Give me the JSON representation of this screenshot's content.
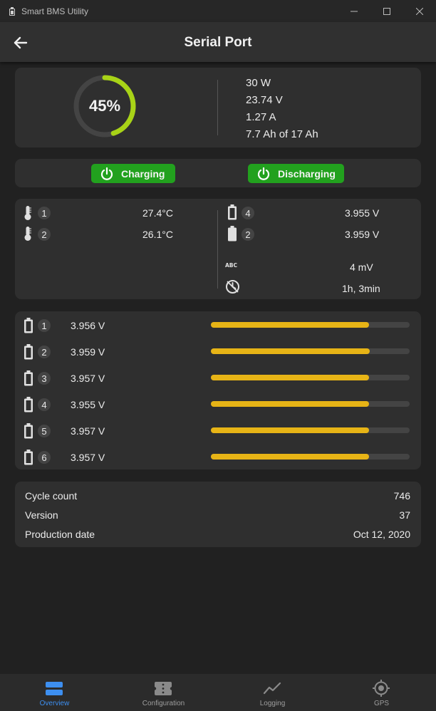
{
  "window": {
    "title": "Smart BMS Utility"
  },
  "appbar": {
    "title": "Serial Port"
  },
  "status": {
    "percent_label": "45%",
    "percent_value": 0.45,
    "power": "30 W",
    "voltage": "23.74 V",
    "current": "1.27 A",
    "capacity": "7.7 Ah of 17 Ah"
  },
  "buttons": {
    "charging": "Charging",
    "discharging": "Discharging"
  },
  "temperatures": [
    {
      "index": "1",
      "value": "27.4°C"
    },
    {
      "index": "2",
      "value": "26.1°C"
    }
  ],
  "cell_extremes": [
    {
      "index": "4",
      "value": "3.955 V",
      "icon": "battery-empty-icon"
    },
    {
      "index": "2",
      "value": "3.959 V",
      "icon": "battery-full-icon"
    }
  ],
  "delta": {
    "icon": "abc-icon",
    "value": "4 mV"
  },
  "time": {
    "icon": "timer-icon",
    "value": "1h, 3min"
  },
  "cells": [
    {
      "index": "1",
      "voltage": "3.956 V",
      "level": 0.796
    },
    {
      "index": "2",
      "voltage": "3.959 V",
      "level": 0.798
    },
    {
      "index": "3",
      "voltage": "3.957 V",
      "level": 0.797
    },
    {
      "index": "4",
      "voltage": "3.955 V",
      "level": 0.795
    },
    {
      "index": "5",
      "voltage": "3.957 V",
      "level": 0.797
    },
    {
      "index": "6",
      "voltage": "3.957 V",
      "level": 0.797
    }
  ],
  "info": [
    {
      "label": "Cycle count",
      "value": "746"
    },
    {
      "label": "Version",
      "value": "37"
    },
    {
      "label": "Production date",
      "value": "Oct 12, 2020"
    }
  ],
  "nav": [
    {
      "label": "Overview",
      "icon": "overview-icon",
      "active": true
    },
    {
      "label": "Configuration",
      "icon": "configuration-icon",
      "active": false
    },
    {
      "label": "Logging",
      "icon": "logging-icon",
      "active": false
    },
    {
      "label": "GPS",
      "icon": "gps-icon",
      "active": false
    }
  ],
  "colors": {
    "background": "#212121",
    "card": "#2f2f2f",
    "gauge_arc": "#a8d317",
    "button_green": "#22a11e",
    "bar_yellow": "#e7b416",
    "nav_active": "#3d8ff0"
  }
}
